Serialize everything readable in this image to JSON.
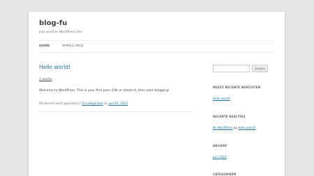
{
  "site": {
    "title": "blog-fu",
    "description": "Just another WordPress site"
  },
  "nav": {
    "items": [
      "HOME",
      "SAMPLE PAGE"
    ]
  },
  "post": {
    "title": "Hello world!",
    "reply": "1 reactie",
    "body": "Welcome to WordPress. This is your first post. Edit or delete it, then start blogging!",
    "meta_prefix": "Dit bericht werd geplaatst in",
    "category": "Uncategorized",
    "meta_on": "op",
    "date": "juni 01, 2014"
  },
  "search": {
    "input_value": "",
    "button_label": "Zoeken"
  },
  "widgets": {
    "recent_posts": {
      "title": "MEEST RECENTE BERICHTEN",
      "items": [
        "Hello world!"
      ]
    },
    "recent_comments": {
      "title": "RECENTE REACTIES",
      "author": "Mr WordPress",
      "op": "op",
      "post": "Hello world!"
    },
    "archive": {
      "title": "ARCHIEF",
      "items": [
        "juni 2014"
      ]
    },
    "categories": {
      "title": "CATEGORIEËN"
    }
  },
  "colors": {
    "link": "#21759b",
    "background": "#e6e6e6",
    "page": "#ffffff"
  }
}
